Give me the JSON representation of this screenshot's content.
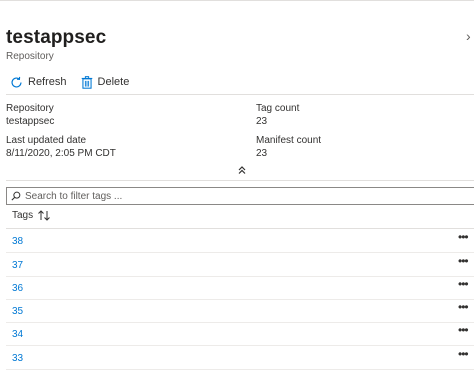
{
  "header": {
    "title": "testappsec",
    "subtitle": "Repository",
    "close_glyph": "›"
  },
  "toolbar": {
    "refresh_label": "Refresh",
    "delete_label": "Delete"
  },
  "essentials": {
    "repository_label": "Repository",
    "repository_value": "testappsec",
    "last_updated_label": "Last updated date",
    "last_updated_value": "8/11/2020, 2:05 PM CDT",
    "tag_count_label": "Tag count",
    "tag_count_value": "23",
    "manifest_count_label": "Manifest count",
    "manifest_count_value": "23"
  },
  "search": {
    "placeholder": "Search to filter tags ..."
  },
  "table": {
    "column_header": "Tags",
    "rows": [
      {
        "tag": "38",
        "more": "•••"
      },
      {
        "tag": "37",
        "more": "•••"
      },
      {
        "tag": "36",
        "more": "•••"
      },
      {
        "tag": "35",
        "more": "•••"
      },
      {
        "tag": "34",
        "more": "•••"
      },
      {
        "tag": "33",
        "more": "•••"
      }
    ]
  },
  "colors": {
    "accent": "#0078d4",
    "text": "#323130",
    "border": "#e1dfdd"
  },
  "icons": [
    "refresh-icon",
    "delete-icon",
    "collapse-chevron-icon",
    "search-icon",
    "sort-icon",
    "more-icon",
    "close-icon"
  ]
}
